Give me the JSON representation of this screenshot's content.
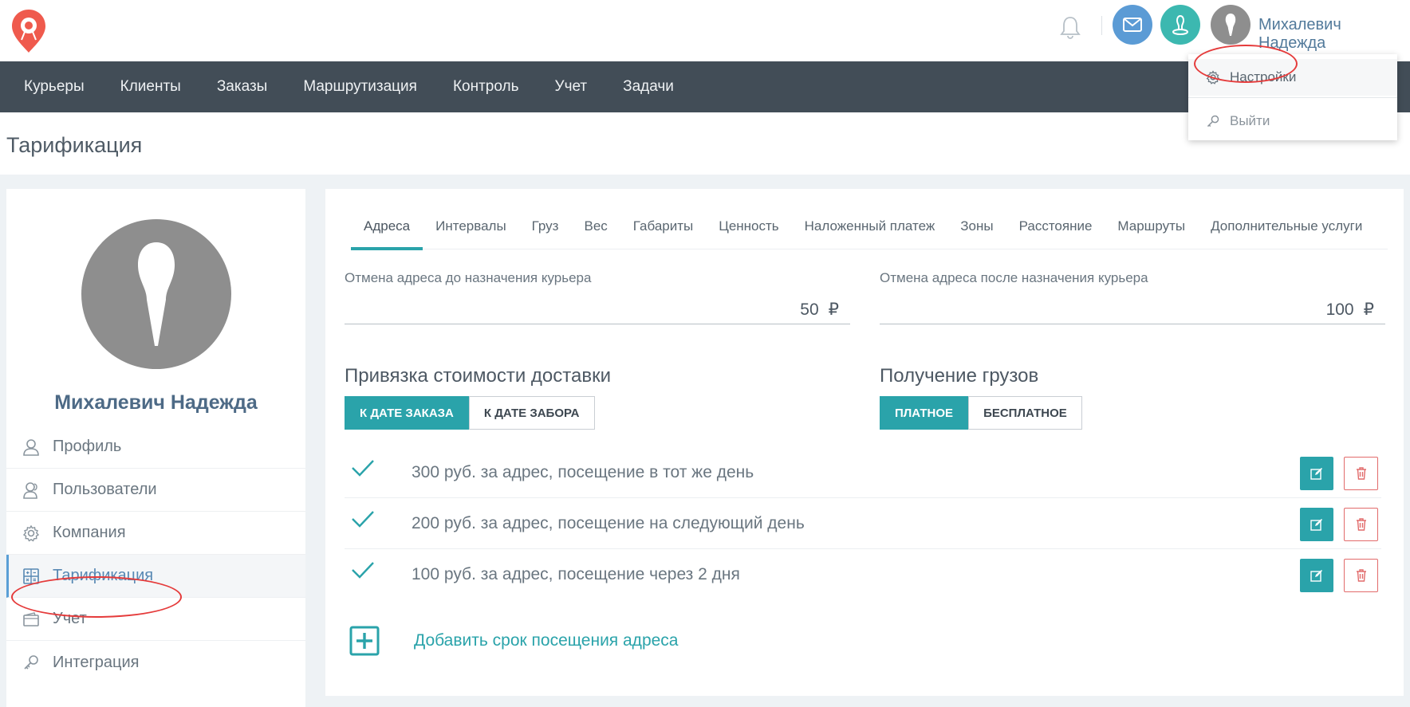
{
  "header": {
    "logo_icon": "pin-logo-icon",
    "user_name": "Михалевич Надежда",
    "icons": [
      "bell-icon",
      "mail-icon",
      "courier-icon",
      "user-avatar-icon"
    ]
  },
  "navbar": {
    "items": [
      {
        "label": "Курьеры"
      },
      {
        "label": "Клиенты"
      },
      {
        "label": "Заказы"
      },
      {
        "label": "Маршрутизация"
      },
      {
        "label": "Контроль"
      },
      {
        "label": "Учет"
      },
      {
        "label": "Задачи"
      }
    ]
  },
  "user_menu": {
    "settings_label": "Настройки",
    "logout_label": "Выйти"
  },
  "page": {
    "title": "Тарификация"
  },
  "profile": {
    "name": "Михалевич Надежда",
    "menu": [
      {
        "label": "Профиль",
        "icon": "user-icon"
      },
      {
        "label": "Пользователи",
        "icon": "users-icon"
      },
      {
        "label": "Компания",
        "icon": "gear-icon"
      },
      {
        "label": "Тарификация",
        "icon": "calculator-icon",
        "active": true
      },
      {
        "label": "Учет",
        "icon": "wallet-icon"
      },
      {
        "label": "Интеграция",
        "icon": "key-icon"
      }
    ]
  },
  "tabs": [
    {
      "label": "Адреса",
      "active": true
    },
    {
      "label": "Интервалы"
    },
    {
      "label": "Груз"
    },
    {
      "label": "Вес"
    },
    {
      "label": "Габариты"
    },
    {
      "label": "Ценность"
    },
    {
      "label": "Наложенный платеж"
    },
    {
      "label": "Зоны"
    },
    {
      "label": "Расстояние"
    },
    {
      "label": "Маршруты"
    },
    {
      "label": "Дополнительные услуги"
    }
  ],
  "fields": {
    "cancel_before": {
      "label": "Отмена адреса до назначения курьера",
      "value": "50",
      "currency": "₽"
    },
    "cancel_after": {
      "label": "Отмена адреса после назначения курьера",
      "value": "100",
      "currency": "₽"
    }
  },
  "binding": {
    "title": "Привязка стоимости доставки",
    "options": [
      "К ДАТЕ ЗАКАЗА",
      "К ДАТЕ ЗАБОРА"
    ],
    "selected": "К ДАТЕ ЗАКАЗА"
  },
  "cargo": {
    "title": "Получение грузов",
    "options": [
      "ПЛАТНОЕ",
      "БЕСПЛАТНОЕ"
    ],
    "selected": "ПЛАТНОЕ"
  },
  "rates": [
    {
      "text": "300 руб. за адрес, посещение в тот же день"
    },
    {
      "text": "200 руб. за адрес, посещение на следующий день"
    },
    {
      "text": "100 руб. за адрес, посещение через 2 дня"
    }
  ],
  "add_label": "Добавить срок посещения адреса",
  "colors": {
    "accent": "#2aa3aa",
    "navbar": "#424d57",
    "link_blue": "#527a9b",
    "danger": "#e26b6b",
    "highlight_ellipse": "#e53b3b"
  }
}
